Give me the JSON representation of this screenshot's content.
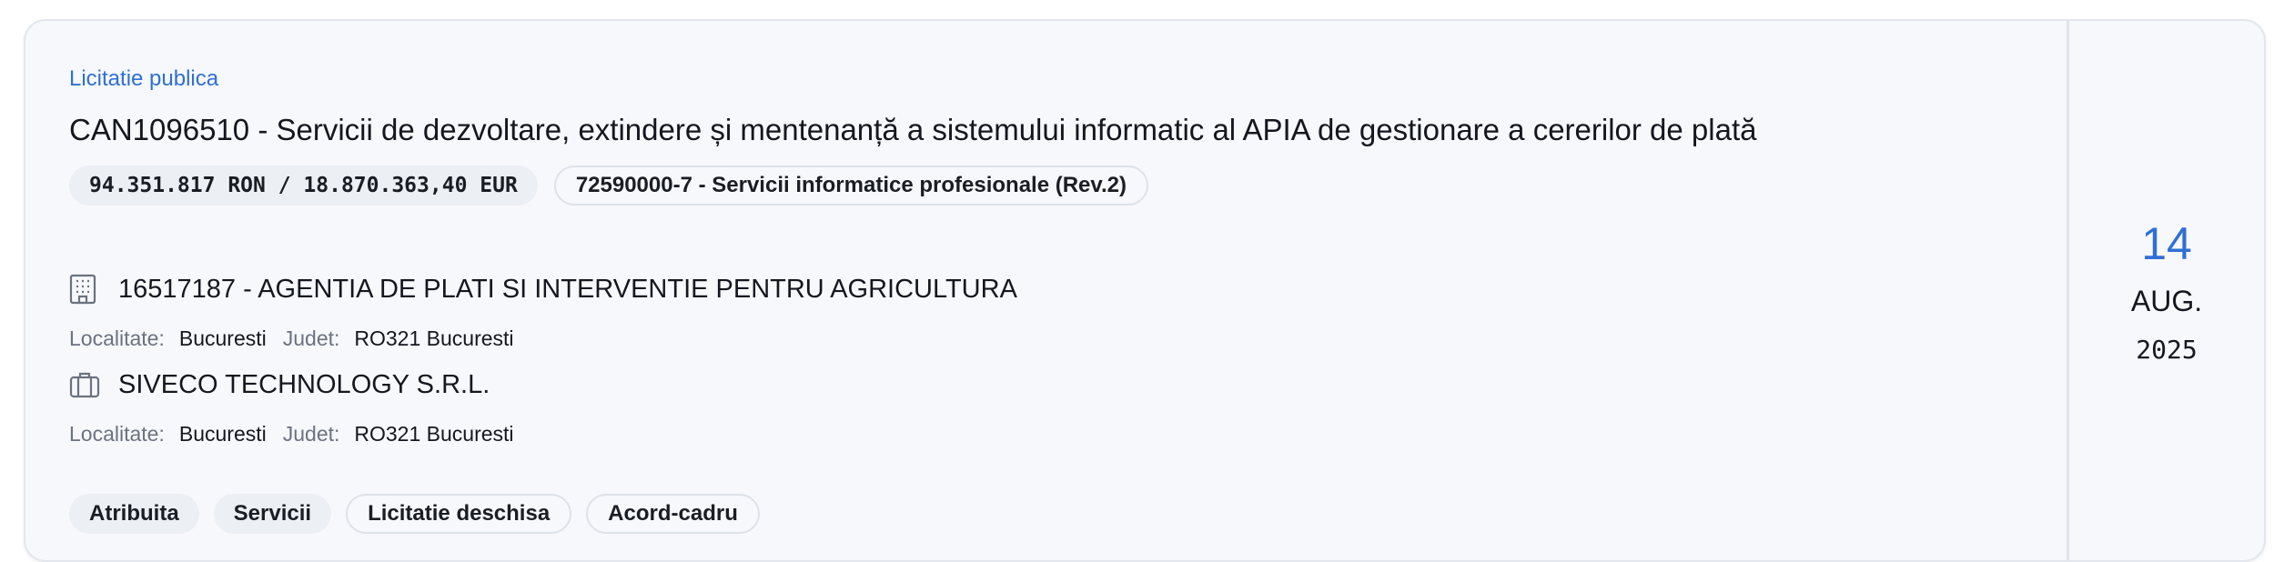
{
  "notice": {
    "type_label": "Licitatie publica",
    "title": "CAN1096510 - Servicii de dezvoltare, extindere și mentenanță a sistemului informatic al APIA de gestionare a cererilor de plată",
    "value": "94.351.817 RON / 18.870.363,40 EUR",
    "cpv": "72590000-7 - Servicii informatice profesionale (Rev.2)"
  },
  "authority": {
    "icon": "building-icon",
    "name": "16517187 - AGENTIA DE PLATI SI INTERVENTIE PENTRU AGRICULTURA",
    "locality_label": "Localitate:",
    "locality": "Bucuresti",
    "county_label": "Judet:",
    "county": "RO321 Bucuresti"
  },
  "supplier": {
    "icon": "briefcase-icon",
    "name": "SIVECO TECHNOLOGY S.R.L.",
    "locality_label": "Localitate:",
    "locality": "Bucuresti",
    "county_label": "Judet:",
    "county": "RO321 Bucuresti"
  },
  "tags": [
    {
      "label": "Atribuita",
      "style": "filled"
    },
    {
      "label": "Servicii",
      "style": "filled"
    },
    {
      "label": "Licitatie deschisa",
      "style": "outline"
    },
    {
      "label": "Acord-cadru",
      "style": "outline"
    }
  ],
  "date": {
    "day": "14",
    "month": "AUG.",
    "year": "2025"
  },
  "colors": {
    "accent": "#2f6fd6",
    "card_bg": "#f6f8fb",
    "chip_bg": "#eceff4",
    "border": "#e3e7ed"
  }
}
